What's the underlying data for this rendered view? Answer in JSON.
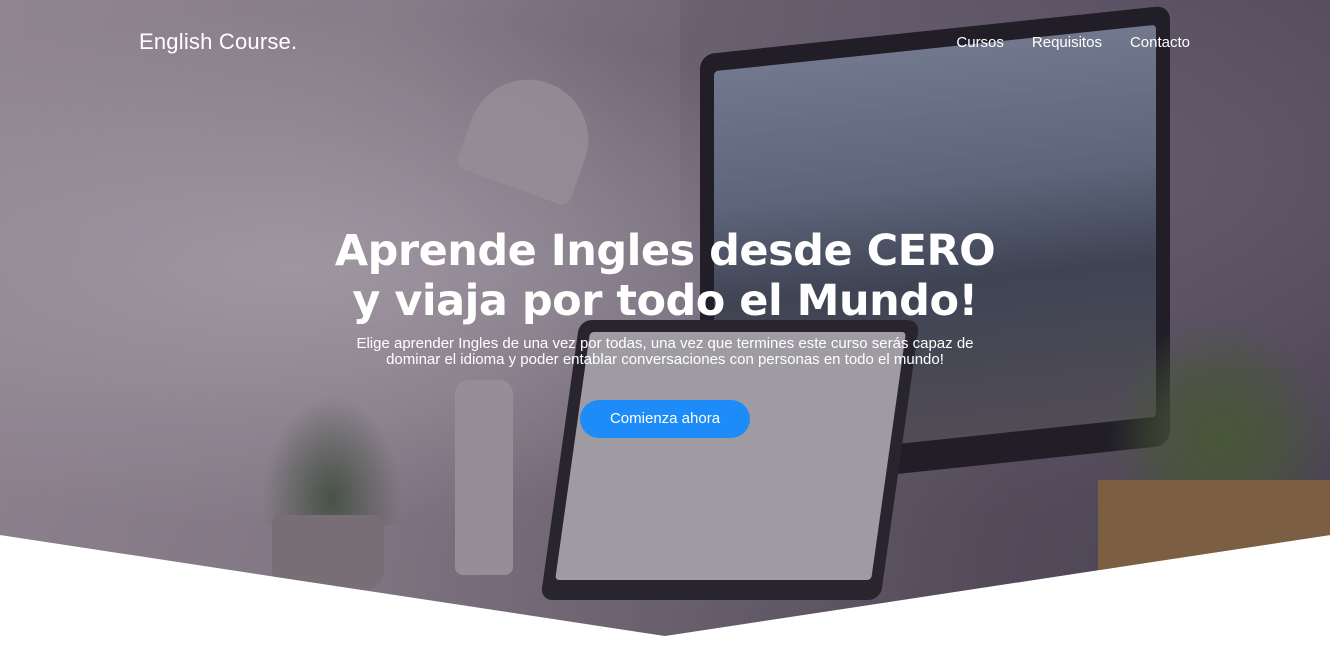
{
  "brand": {
    "name": "English Course."
  },
  "nav": {
    "items": [
      {
        "label": "Cursos"
      },
      {
        "label": "Requisitos"
      },
      {
        "label": "Contacto"
      }
    ]
  },
  "hero": {
    "headline": "Aprende Ingles desde CERO y viaja por todo el Mundo!",
    "subtext": "Elige aprender Ingles de una vez por todas, una vez que termines este curso serás capaz de dominar el idioma y poder entablar conversaciones con personas en todo el mundo!",
    "cta_label": "Comienza ahora"
  },
  "colors": {
    "accent": "#1e8cf8",
    "text": "#ffffff",
    "page_background": "#ffffff"
  }
}
